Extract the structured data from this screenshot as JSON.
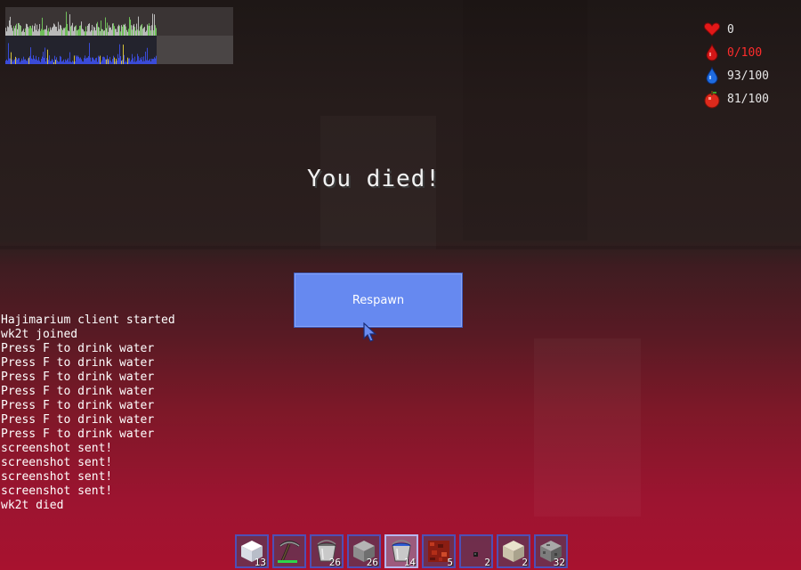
{
  "hud": {
    "stats": [
      {
        "icon": "heart-icon",
        "text": "0",
        "alert": false
      },
      {
        "icon": "blood-drop-icon",
        "text": "0/100",
        "alert": true
      },
      {
        "icon": "water-drop-icon",
        "text": "93/100",
        "alert": false
      },
      {
        "icon": "apple-icon",
        "text": "81/100",
        "alert": false
      }
    ]
  },
  "death_screen": {
    "title": "You died!",
    "respawn_label": "Respawn"
  },
  "chat": {
    "lines": [
      "Hajimarium client started",
      "wk2t joined",
      "Press F to drink water",
      "Press F to drink water",
      "Press F to drink water",
      "Press F to drink water",
      "Press F to drink water",
      "Press F to drink water",
      "Press F to drink water",
      "screenshot sent!",
      "screenshot sent!",
      "screenshot sent!",
      "screenshot sent!",
      "wk2t died"
    ]
  },
  "hotbar": {
    "selected_index": 4,
    "slots": [
      {
        "item": "snow-block-icon",
        "count": "13"
      },
      {
        "item": "pickaxe-icon",
        "count": ""
      },
      {
        "item": "empty-bucket-icon",
        "count": "26"
      },
      {
        "item": "stone-block-icon",
        "count": "26"
      },
      {
        "item": "water-bucket-icon",
        "count": "14"
      },
      {
        "item": "netherrack-block-icon",
        "count": "5"
      },
      {
        "item": "coal-lump-icon",
        "count": "2"
      },
      {
        "item": "sand-block-icon",
        "count": "2"
      },
      {
        "item": "cobblestone-block-icon",
        "count": "32"
      }
    ]
  }
}
